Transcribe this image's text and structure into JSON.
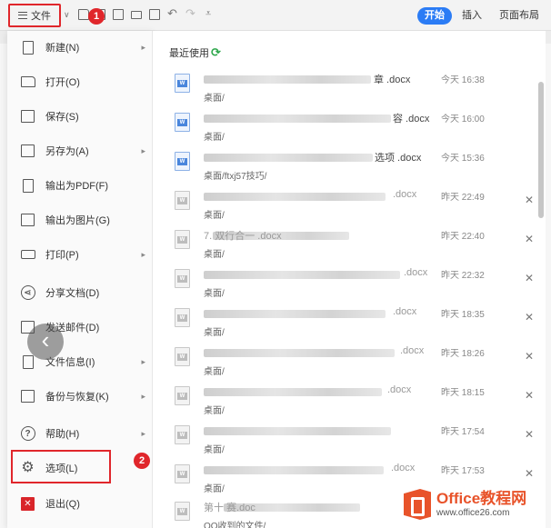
{
  "toolbar": {
    "file_label": "文件",
    "tabs": [
      {
        "label": "开始",
        "active": true
      },
      {
        "label": "插入",
        "active": false
      },
      {
        "label": "页面布局",
        "active": false
      }
    ]
  },
  "markers": {
    "first": "1",
    "second": "2"
  },
  "menu": {
    "items": [
      {
        "label": "新建(N)",
        "icon": "new-doc-icon",
        "submenu": true
      },
      {
        "label": "打开(O)",
        "icon": "folder-icon",
        "submenu": false
      },
      {
        "label": "保存(S)",
        "icon": "save-icon",
        "submenu": false
      },
      {
        "label": "另存为(A)",
        "icon": "save-as-icon",
        "submenu": true
      },
      {
        "label": "输出为PDF(F)",
        "icon": "pdf-icon",
        "submenu": false
      },
      {
        "label": "输出为图片(G)",
        "icon": "image-icon",
        "submenu": false
      },
      {
        "label": "打印(P)",
        "icon": "printer-icon",
        "submenu": true
      },
      {
        "label": "分享文档(D)",
        "icon": "share-icon",
        "submenu": false
      },
      {
        "label": "发送邮件(D)",
        "icon": "mail-icon",
        "submenu": false
      },
      {
        "label": "文件信息(I)",
        "icon": "info-icon",
        "submenu": true
      },
      {
        "label": "备份与恢复(K)",
        "icon": "backup-icon",
        "submenu": true
      },
      {
        "label": "帮助(H)",
        "icon": "help-icon",
        "submenu": true
      },
      {
        "label": "选项(L)",
        "icon": "gear-icon",
        "submenu": false
      },
      {
        "label": "退出(Q)",
        "icon": "exit-icon",
        "submenu": false
      }
    ]
  },
  "recent": {
    "title": "最近使用",
    "files": [
      {
        "name_tail": "章 .docx",
        "path": "桌面/",
        "time": "今天 16:38",
        "closable": false,
        "faded": false
      },
      {
        "name_tail": "容 .docx",
        "path": "桌面/",
        "time": "今天 16:00",
        "closable": false,
        "faded": false
      },
      {
        "name_tail": "选项 .docx",
        "path": "桌面/ftxj57技巧/",
        "time": "今天 15:36",
        "closable": false,
        "faded": false
      },
      {
        "name_tail": ".docx",
        "path": "桌面/",
        "time": "昨天 22:49",
        "closable": true,
        "faded": true
      },
      {
        "name_tail": "7. 双行合一 .docx",
        "path": "桌面/",
        "time": "昨天 22:40",
        "closable": true,
        "faded": true
      },
      {
        "name_tail": ".docx",
        "path": "桌面/",
        "time": "昨天 22:32",
        "closable": true,
        "faded": true
      },
      {
        "name_tail": ".docx",
        "path": "桌面/",
        "time": "昨天 18:35",
        "closable": true,
        "faded": true
      },
      {
        "name_tail": ".docx",
        "path": "桌面/",
        "time": "昨天 18:26",
        "closable": true,
        "faded": true
      },
      {
        "name_tail": ".docx",
        "path": "桌面/",
        "time": "昨天 18:15",
        "closable": true,
        "faded": true
      },
      {
        "name_tail": "",
        "path": "桌面/",
        "time": "昨天 17:54",
        "closable": true,
        "faded": true
      },
      {
        "name_tail": ".docx",
        "path": "桌面/",
        "time": "昨天 17:53",
        "closable": true,
        "faded": true
      },
      {
        "name_tail": "第十 赛.doc",
        "path": "QQ收到的文件/",
        "time": "",
        "closable": false,
        "faded": true
      }
    ]
  },
  "watermark": {
    "brand": "Office教程网",
    "url": "www.office26.com"
  }
}
